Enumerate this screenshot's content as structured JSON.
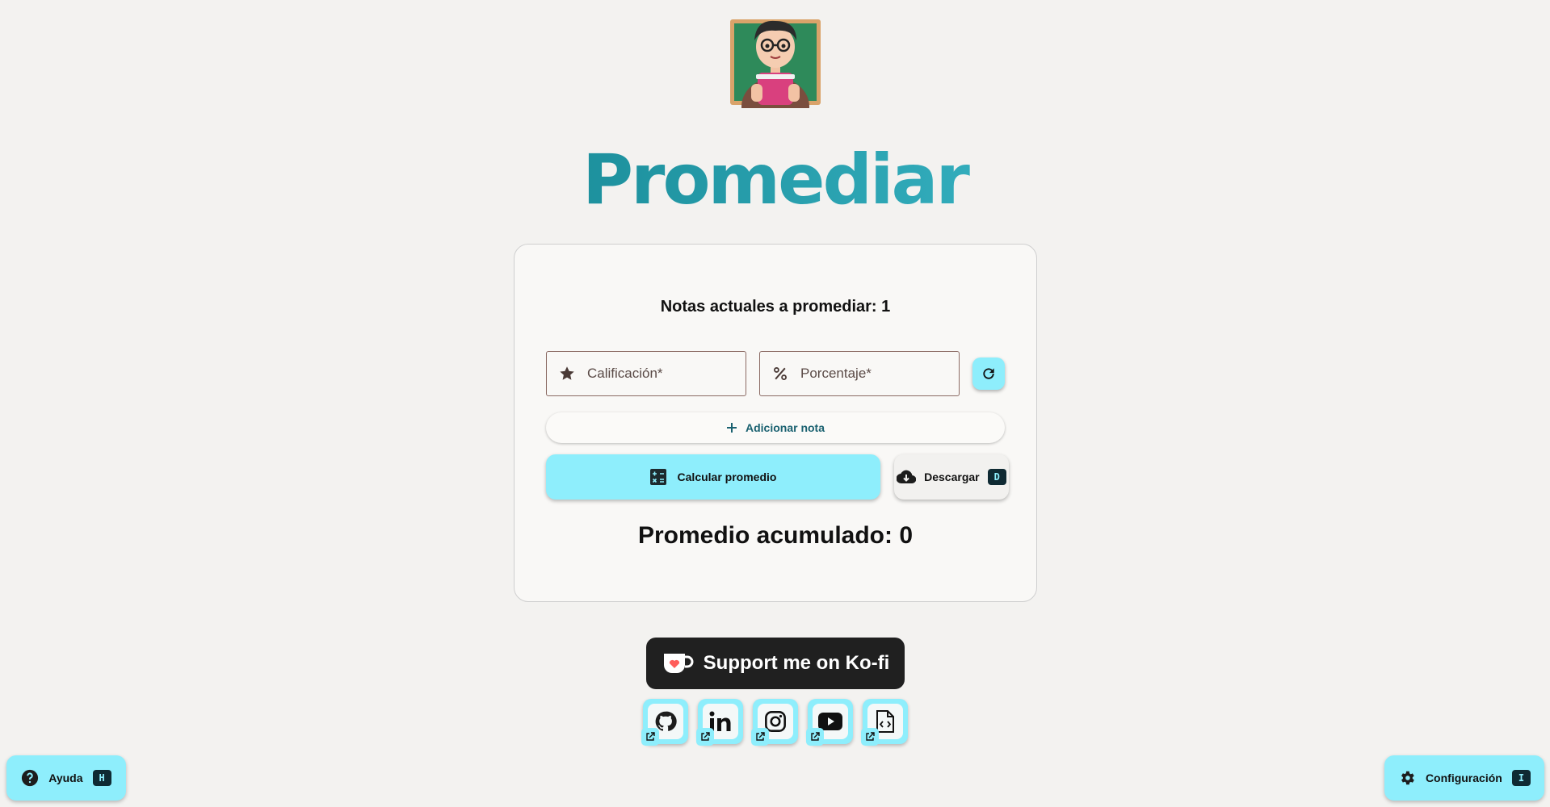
{
  "app": {
    "title": "Promediar"
  },
  "card": {
    "count_label": "Notas actuales a promediar: 1",
    "grade_placeholder": "Calificación*",
    "percent_placeholder": "Porcentaje*",
    "add_note_label": "Adicionar nota",
    "calc_label": "Calcular promedio",
    "download_label": "Descargar",
    "download_shortcut": "D",
    "average_label": "Promedio acumulado: 0"
  },
  "kofi": {
    "label": "Support me on Ko-fi"
  },
  "socials": [
    {
      "icon": "github-icon"
    },
    {
      "icon": "linkedin-icon"
    },
    {
      "icon": "instagram-icon"
    },
    {
      "icon": "youtube-icon"
    },
    {
      "icon": "code-file-icon"
    }
  ],
  "help": {
    "label": "Ayuda",
    "shortcut": "H"
  },
  "config": {
    "label": "Configuración",
    "shortcut": "I"
  },
  "colors": {
    "accent": "#8eeefc",
    "title_start": "#0e7380",
    "title_end": "#5ccfdd",
    "dark": "#202020"
  }
}
